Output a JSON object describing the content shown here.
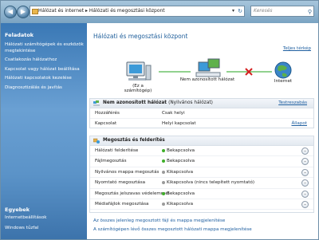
{
  "addressbar": {
    "path_root": "Hálózat és internet",
    "path_sep": "▸",
    "path_current": "Hálózati és megosztási központ",
    "search_placeholder": "Keresés"
  },
  "sidebar": {
    "tasks_title": "Feladatok",
    "tasks": [
      "Hálózati számítógépek és eszközök megtekintése",
      "Csatlakozás hálózathoz",
      "Kapcsolat vagy hálózat beállítása",
      "Hálózati kapcsolatok kezelése",
      "Diagnosztizálás és javítás"
    ],
    "see_also_title": "Egyebek",
    "see_also": [
      "Internetbeállítások",
      "Windows tűzfal"
    ]
  },
  "main": {
    "title": "Hálózati és megosztási központ",
    "full_map": "Teljes térkép",
    "map": {
      "computer": "(Ez a számítógép)",
      "network": "Nem azonosított hálózat",
      "internet": "Internet"
    },
    "network": {
      "name": "Nem azonosított hálózat",
      "type": "(Nyilvános hálózat)",
      "customize": "Testreszabás",
      "rows": [
        {
          "key": "Hozzáférés",
          "value": "Csak helyi",
          "link": ""
        },
        {
          "key": "Kapcsolat",
          "value": "Helyi kapcsolat",
          "link": "Állapot"
        }
      ]
    },
    "sharing": {
      "title": "Megosztás és felderítés",
      "rows": [
        {
          "key": "Hálózati felderítése",
          "value": "Bekapcsolva",
          "status": "on"
        },
        {
          "key": "Fájlmegosztás",
          "value": "Bekapcsolva",
          "status": "on"
        },
        {
          "key": "Nyilvános mappa megosztás",
          "value": "Kikapcsolva",
          "status": "off"
        },
        {
          "key": "Nyomtató megosztása",
          "value": "Kikapcsolva (nincs telepített nyomtató)",
          "status": "off"
        },
        {
          "key": "Megosztás jelszavas védelemmel",
          "value": "Bekapcsolva",
          "status": "on"
        },
        {
          "key": "Médiafájlok megosztása",
          "value": "Kikapcsolva",
          "status": "off"
        }
      ]
    },
    "bottom_links": [
      "Az összes jelenleg megosztott fájl és mappa megjelenítése",
      "A számítógépen lévő összes megosztott hálózati mappa megjelenítése"
    ]
  },
  "colors": {
    "on": "#3fae2a",
    "off": "#9a9a9a",
    "link": "#1f5fa0",
    "sidebar": "#4a86c0"
  }
}
